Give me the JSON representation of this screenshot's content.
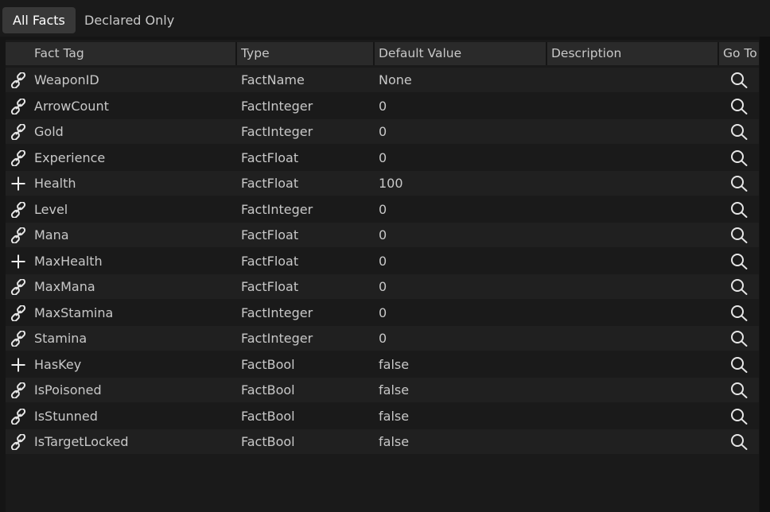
{
  "tabs": [
    {
      "label": "All Facts",
      "active": true
    },
    {
      "label": "Declared Only",
      "active": false
    }
  ],
  "columns": {
    "tag": "Fact Tag",
    "type": "Type",
    "default": "Default Value",
    "description": "Description",
    "goto": "Go To"
  },
  "rows": [
    {
      "icon": "link-icon",
      "tag": "WeaponID",
      "type": "FactName",
      "default": "None",
      "description": ""
    },
    {
      "icon": "link-icon",
      "tag": "ArrowCount",
      "type": "FactInteger",
      "default": "0",
      "description": ""
    },
    {
      "icon": "link-icon",
      "tag": "Gold",
      "type": "FactInteger",
      "default": "0",
      "description": ""
    },
    {
      "icon": "link-icon",
      "tag": "Experience",
      "type": "FactFloat",
      "default": "0",
      "description": ""
    },
    {
      "icon": "plus-icon",
      "tag": "Health",
      "type": "FactFloat",
      "default": "100",
      "description": ""
    },
    {
      "icon": "link-icon",
      "tag": "Level",
      "type": "FactInteger",
      "default": "0",
      "description": ""
    },
    {
      "icon": "link-icon",
      "tag": "Mana",
      "type": "FactFloat",
      "default": "0",
      "description": ""
    },
    {
      "icon": "plus-icon",
      "tag": "MaxHealth",
      "type": "FactFloat",
      "default": "0",
      "description": ""
    },
    {
      "icon": "link-icon",
      "tag": "MaxMana",
      "type": "FactFloat",
      "default": "0",
      "description": ""
    },
    {
      "icon": "link-icon",
      "tag": "MaxStamina",
      "type": "FactInteger",
      "default": "0",
      "description": ""
    },
    {
      "icon": "link-icon",
      "tag": "Stamina",
      "type": "FactInteger",
      "default": "0",
      "description": ""
    },
    {
      "icon": "plus-icon",
      "tag": "HasKey",
      "type": "FactBool",
      "default": "false",
      "description": ""
    },
    {
      "icon": "link-icon",
      "tag": "IsPoisoned",
      "type": "FactBool",
      "default": "false",
      "description": ""
    },
    {
      "icon": "link-icon",
      "tag": "IsStunned",
      "type": "FactBool",
      "default": "false",
      "description": ""
    },
    {
      "icon": "link-icon",
      "tag": "IsTargetLocked",
      "type": "FactBool",
      "default": "false",
      "description": ""
    }
  ],
  "colors": {
    "background": "#151515",
    "panel": "#1a1a1a",
    "header": "#2a2a2a",
    "row_alt": "#202020",
    "text": "#c8c8c8",
    "icon": "#e6e6e6"
  }
}
